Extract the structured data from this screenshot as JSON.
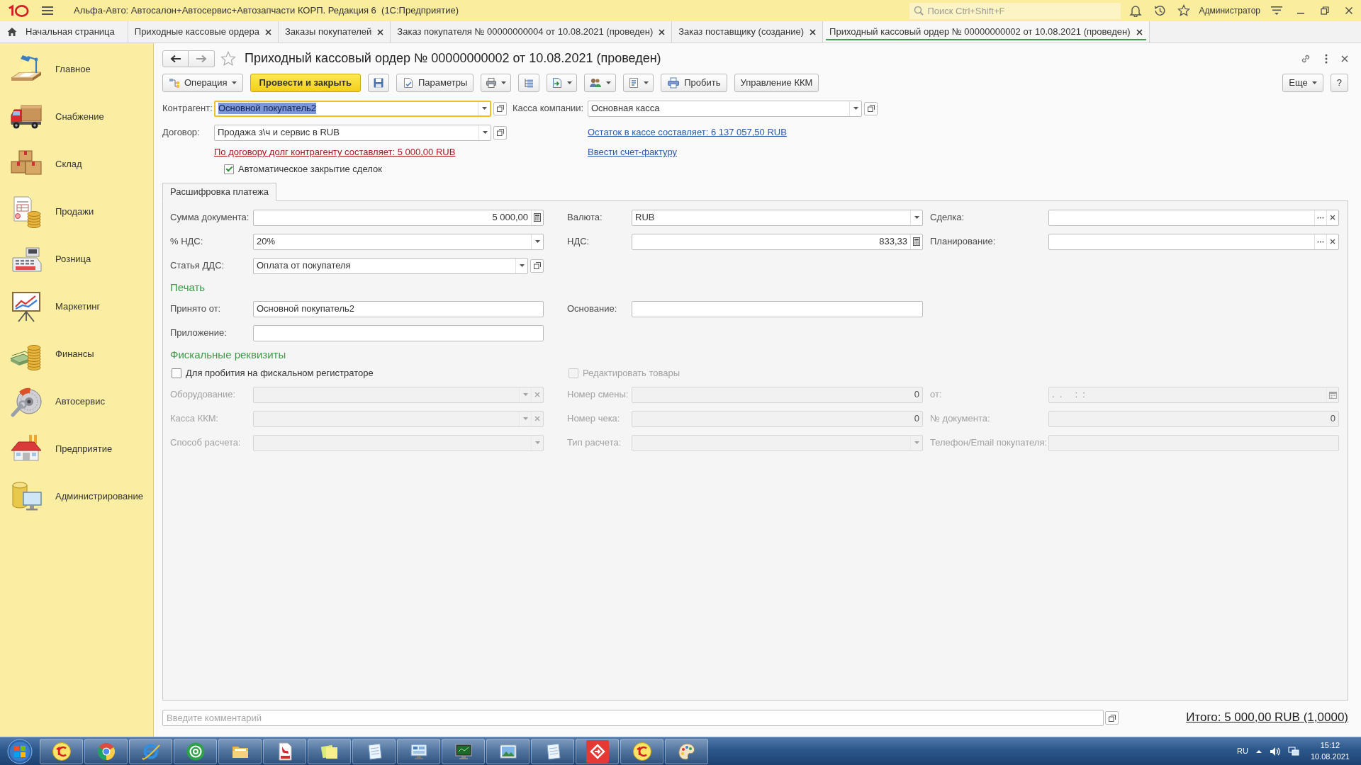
{
  "window": {
    "title": "Альфа-Авто: Автосалон+Автосервис+Автозапчасти КОРП. Редакция 6  (1С:Предприятие)",
    "search": {
      "placeholder": "Поиск Ctrl+Shift+F"
    },
    "user": "Администратор"
  },
  "tabs": [
    {
      "label": "Начальная страница",
      "kind": "home",
      "selected": false
    },
    {
      "label": "Приходные кассовые ордера",
      "kind": "page",
      "selected": false
    },
    {
      "label": "Заказы покупателей",
      "kind": "page",
      "selected": false
    },
    {
      "label": "Заказ покупателя № 00000000004 от 10.08.2021 (проведен)",
      "kind": "page",
      "selected": false
    },
    {
      "label": "Заказ поставщику (создание)",
      "kind": "page",
      "selected": false
    },
    {
      "label": "Приходный кассовый ордер № 00000000002 от 10.08.2021 (проведен)",
      "kind": "page",
      "selected": true
    }
  ],
  "sidebar": {
    "items": [
      {
        "label": "Главное",
        "kind": "main"
      },
      {
        "label": "Снабжение",
        "kind": "supply"
      },
      {
        "label": "Склад",
        "kind": "warehouse"
      },
      {
        "label": "Продажи",
        "kind": "sales"
      },
      {
        "label": "Розница",
        "kind": "retail"
      },
      {
        "label": "Маркетинг",
        "kind": "marketing"
      },
      {
        "label": "Финансы",
        "kind": "finance"
      },
      {
        "label": "Автосервис",
        "kind": "service"
      },
      {
        "label": "Предприятие",
        "kind": "enterprise"
      },
      {
        "label": "Администрирование",
        "kind": "admin"
      }
    ]
  },
  "form": {
    "title": "Приходный кассовый ордер № 00000000002 от 10.08.2021 (проведен)",
    "starred": false,
    "toolbar": [
      {
        "kind": "operation",
        "label": "Операция"
      },
      {
        "kind": "post",
        "label": "Провести и закрыть"
      },
      {
        "kind": "save"
      },
      {
        "kind": "params",
        "label": "Параметры"
      },
      {
        "kind": "print"
      },
      {
        "kind": "structure"
      },
      {
        "kind": "generate"
      },
      {
        "kind": "users"
      },
      {
        "kind": "report"
      },
      {
        "kind": "receipt",
        "label": "Пробить"
      },
      {
        "kind": "plain",
        "label": "Управление ККМ"
      },
      {
        "kind": "more",
        "label": "Еще"
      },
      {
        "kind": "help",
        "label": "?"
      }
    ],
    "header": {
      "rows": [
        {
          "left": {
            "kind": "field",
            "label": "Контрагент:",
            "value": "Основной покупатель2",
            "buttons": [
              {
                "kind": "dropdown"
              },
              {
                "kind": "open"
              }
            ],
            "focused": true
          },
          "right": {
            "kind": "field",
            "label": "Касса компании:",
            "value": "Основная касса",
            "buttons": [
              {
                "kind": "dropdown"
              },
              {
                "kind": "open"
              }
            ],
            "focused": false
          }
        },
        {
          "left": {
            "kind": "field",
            "label": "Договор:",
            "value": "Продажа з\\ч и сервис в RUB",
            "buttons": [
              {
                "kind": "dropdown"
              },
              {
                "kind": "open"
              }
            ],
            "focused": false
          },
          "right": {
            "kind": "link",
            "text": "Остаток в кассе составляет: 6 137 057,50 RUB"
          }
        },
        {
          "left": {
            "kind": "alertlink",
            "text": "По договору долг контрагенту составляет: 5 000,00 RUB"
          },
          "right": {
            "kind": "link",
            "text": "Ввести счет-фактуру"
          }
        },
        {
          "left": {
            "kind": "checkbox",
            "label": "Автоматическое закрытие сделок",
            "checked": true
          }
        }
      ]
    },
    "tab": {
      "label": "Расшифровка платежа",
      "selected": true
    },
    "rows": [
      {
        "kind": "fields",
        "fields": [
          {
            "label": "Сумма документа:",
            "kind": "number",
            "value": "5 000,00",
            "buttons": [
              {
                "kind": "calc"
              }
            ],
            "disabled": false
          },
          {
            "label": "Валюта:",
            "kind": "text",
            "value": "RUB",
            "buttons": [
              {
                "kind": "dropdown"
              }
            ],
            "disabled": false
          },
          {
            "label": "Сделка:",
            "kind": "text",
            "buttons": [
              {
                "kind": "choose"
              },
              {
                "kind": "clear"
              }
            ],
            "disabled": false
          }
        ]
      },
      {
        "kind": "fields",
        "fields": [
          {
            "label": "% НДС:",
            "kind": "text",
            "value": "20%",
            "buttons": [
              {
                "kind": "dropdown"
              }
            ],
            "disabled": false
          },
          {
            "label": "НДС:",
            "kind": "number",
            "value": "833,33",
            "buttons": [
              {
                "kind": "calc"
              }
            ],
            "disabled": false
          },
          {
            "label": "Планирование:",
            "kind": "text",
            "buttons": [
              {
                "kind": "choose"
              },
              {
                "kind": "clear"
              }
            ],
            "disabled": false
          }
        ]
      },
      {
        "kind": "fields",
        "fields": [
          {
            "label": "Статья ДДС:",
            "kind": "text",
            "value": "Оплата от покупателя",
            "buttons": [
              {
                "kind": "dropdown"
              },
              {
                "kind": "open"
              }
            ],
            "disabled": false
          }
        ]
      },
      {
        "kind": "heading",
        "text": "Печать"
      },
      {
        "kind": "fields",
        "fields": [
          {
            "label": "Принято от:",
            "kind": "text",
            "value": "Основной покупатель2",
            "disabled": false
          },
          {
            "label": "Основание:",
            "kind": "text",
            "disabled": false
          }
        ]
      },
      {
        "kind": "fields",
        "fields": [
          {
            "label": "Приложение:",
            "kind": "text",
            "disabled": false
          }
        ]
      },
      {
        "kind": "heading",
        "text": "Фискальные реквизиты"
      },
      {
        "kind": "checks",
        "checks": [
          {
            "label": "Для пробития на фискальном регистраторе",
            "checked": false,
            "disabled": false
          },
          {
            "label": "Редактировать товары",
            "checked": false,
            "disabled": true
          }
        ]
      },
      {
        "kind": "fields",
        "fields": [
          {
            "label": "Оборудование:",
            "kind": "text",
            "buttons": [
              {
                "kind": "dropdown"
              },
              {
                "kind": "clear"
              }
            ],
            "disabled": true
          },
          {
            "label": "Номер смены:",
            "kind": "number",
            "value": "0",
            "disabled": true
          },
          {
            "label": "от:",
            "kind": "date",
            "value": ".  .     :  :",
            "buttons": [
              {
                "kind": "calendar"
              }
            ],
            "disabled": true
          }
        ]
      },
      {
        "kind": "fields",
        "fields": [
          {
            "label": "Касса ККМ:",
            "kind": "text",
            "buttons": [
              {
                "kind": "dropdown"
              },
              {
                "kind": "clear"
              }
            ],
            "disabled": true
          },
          {
            "label": "Номер чека:",
            "kind": "number",
            "value": "0",
            "disabled": true
          },
          {
            "label": "№ документа:",
            "kind": "number",
            "value": "0",
            "disabled": true
          }
        ]
      },
      {
        "kind": "fields",
        "fields": [
          {
            "label": "Способ расчета:",
            "kind": "text",
            "buttons": [
              {
                "kind": "dropdown"
              }
            ],
            "disabled": true
          },
          {
            "label": "Тип расчета:",
            "kind": "text",
            "buttons": [
              {
                "kind": "dropdown"
              }
            ],
            "disabled": true
          },
          {
            "label": "Телефон/Email покупателя:",
            "kind": "text",
            "disabled": true
          }
        ]
      }
    ],
    "comment": {
      "placeholder": "Введите комментарий"
    },
    "total": "Итого: 5 000,00 RUB (1,0000)"
  },
  "taskbar": {
    "apps": [
      {
        "kind": "onec"
      },
      {
        "kind": "chrome"
      },
      {
        "kind": "ie"
      },
      {
        "kind": "mail"
      },
      {
        "kind": "folder"
      },
      {
        "kind": "pdf"
      },
      {
        "kind": "notes"
      },
      {
        "kind": "notepad"
      },
      {
        "kind": "panel"
      },
      {
        "kind": "monitor"
      },
      {
        "kind": "photo"
      },
      {
        "kind": "notepad"
      },
      {
        "kind": "remote"
      },
      {
        "kind": "onec"
      },
      {
        "kind": "paint"
      }
    ],
    "language": "RU",
    "time": "15:12",
    "date": "10.08.2021"
  }
}
